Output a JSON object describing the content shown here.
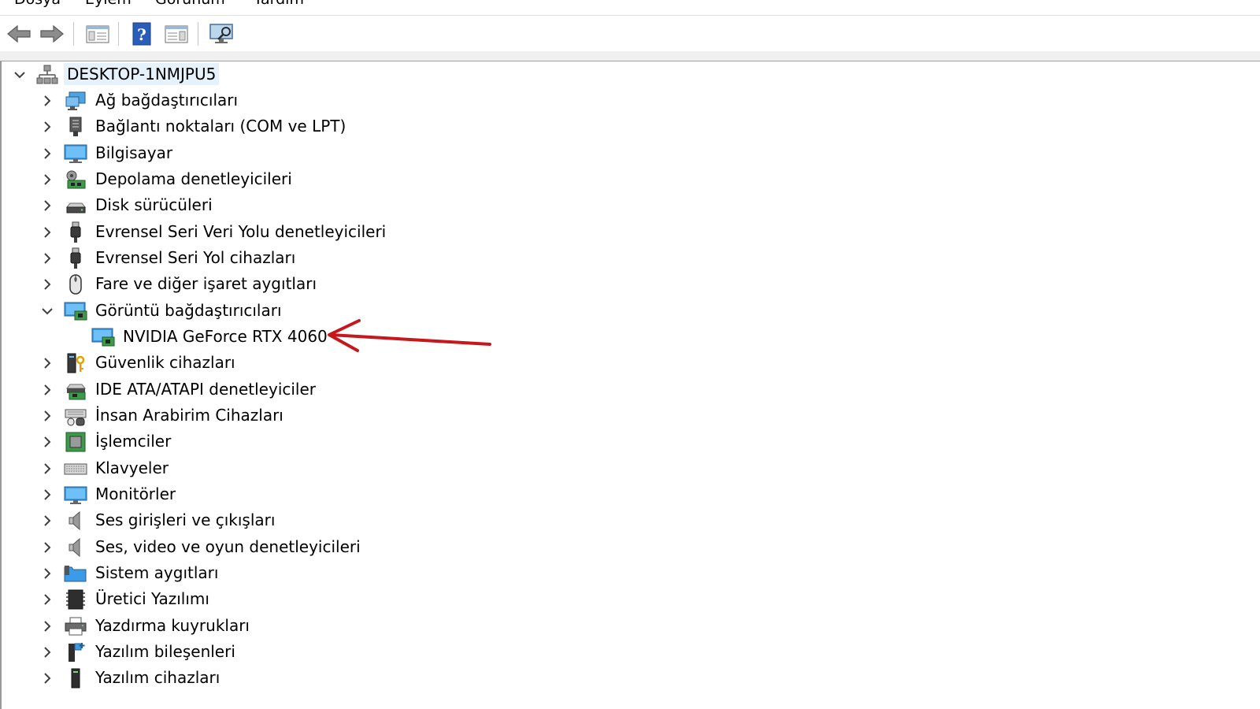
{
  "menu": {
    "items": [
      "Dosya",
      "Eylem",
      "Görünüm",
      "Yardım"
    ]
  },
  "toolbar": {
    "buttons": [
      "back-arrow-icon",
      "forward-arrow-icon",
      "show-hide-tree-icon",
      "help-icon",
      "properties-icon",
      "scan-hardware-icon"
    ]
  },
  "tree": {
    "root": {
      "label": "DESKTOP-1NMJPU5",
      "icon": "computer-network-icon",
      "expanded": true
    },
    "categories": [
      {
        "label": "Ağ bağdaştırıcıları",
        "icon": "network-adapter-icon",
        "expanded": false
      },
      {
        "label": "Bağlantı noktaları (COM ve LPT)",
        "icon": "port-icon",
        "expanded": false
      },
      {
        "label": "Bilgisayar",
        "icon": "computer-icon",
        "expanded": false
      },
      {
        "label": "Depolama denetleyicileri",
        "icon": "storage-controller-icon",
        "expanded": false
      },
      {
        "label": "Disk sürücüleri",
        "icon": "disk-drive-icon",
        "expanded": false
      },
      {
        "label": "Evrensel Seri Veri Yolu denetleyicileri",
        "icon": "usb-controller-icon",
        "expanded": false
      },
      {
        "label": "Evrensel Seri Yol cihazları",
        "icon": "usb-device-icon",
        "expanded": false
      },
      {
        "label": "Fare ve diğer işaret aygıtları",
        "icon": "mouse-icon",
        "expanded": false
      },
      {
        "label": "Görüntü bağdaştırıcıları",
        "icon": "display-adapter-icon",
        "expanded": true,
        "children": [
          {
            "label": "NVIDIA GeForce RTX 4060",
            "icon": "display-adapter-icon"
          }
        ]
      },
      {
        "label": "Güvenlik cihazları",
        "icon": "security-device-icon",
        "expanded": false
      },
      {
        "label": "IDE ATA/ATAPI denetleyiciler",
        "icon": "ide-controller-icon",
        "expanded": false
      },
      {
        "label": "İnsan Arabirim Cihazları",
        "icon": "hid-icon",
        "expanded": false
      },
      {
        "label": "İşlemciler",
        "icon": "processor-icon",
        "expanded": false
      },
      {
        "label": "Klavyeler",
        "icon": "keyboard-icon",
        "expanded": false
      },
      {
        "label": "Monitörler",
        "icon": "monitor-icon",
        "expanded": false
      },
      {
        "label": "Ses girişleri ve çıkışları",
        "icon": "speaker-icon",
        "expanded": false
      },
      {
        "label": "Ses, video ve oyun denetleyicileri",
        "icon": "speaker-icon",
        "expanded": false
      },
      {
        "label": "Sistem aygıtları",
        "icon": "system-devices-icon",
        "expanded": false
      },
      {
        "label": "Üretici Yazılımı",
        "icon": "firmware-icon",
        "expanded": false
      },
      {
        "label": "Yazdırma kuyrukları",
        "icon": "printer-icon",
        "expanded": false
      },
      {
        "label": "Yazılım bileşenleri",
        "icon": "software-component-icon",
        "expanded": false
      },
      {
        "label": "Yazılım cihazları",
        "icon": "software-device-icon",
        "expanded": false
      }
    ]
  },
  "colors": {
    "selection": "#e5f1fb",
    "annotation_arrow": "#c8161d",
    "chevron": "#404040"
  }
}
